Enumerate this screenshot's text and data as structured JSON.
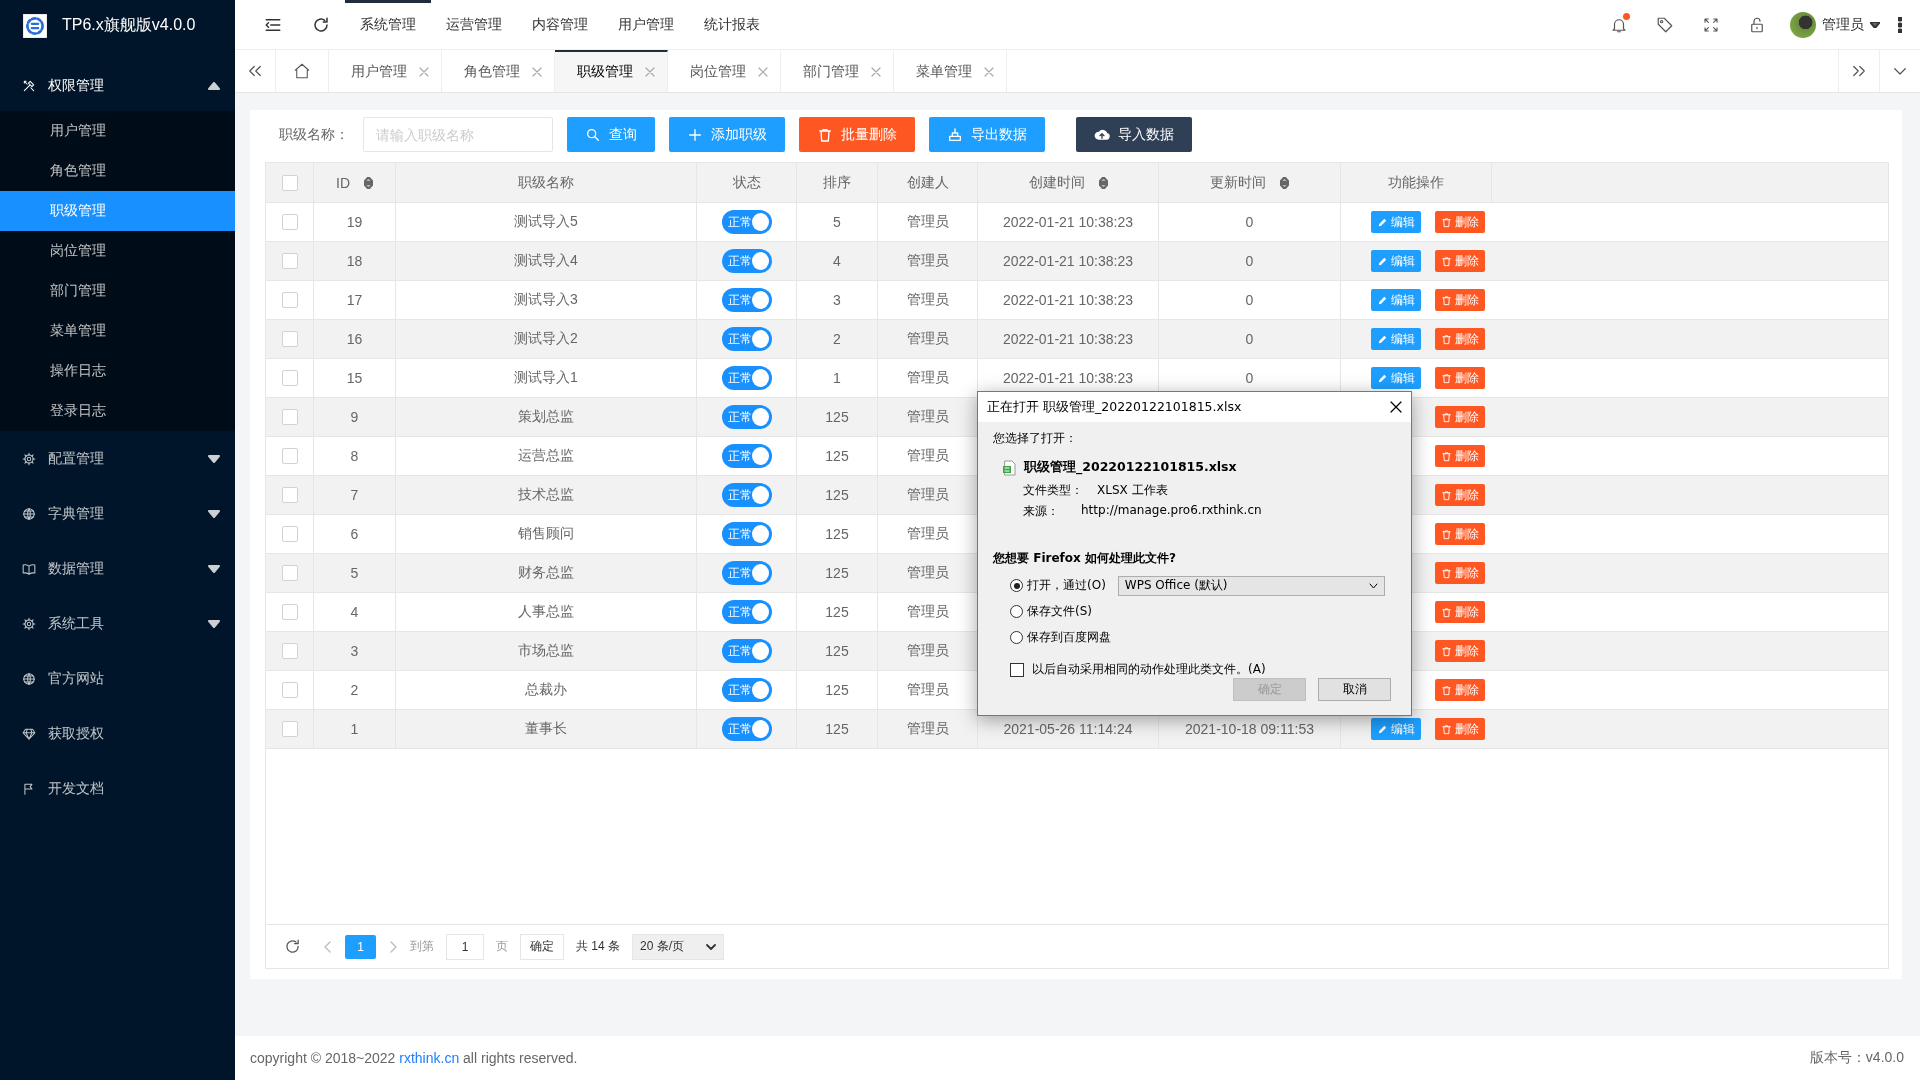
{
  "app": {
    "title": "TP6.x旗舰版v4.0.0"
  },
  "sidebar": {
    "groups": [
      {
        "label": "权限管理",
        "kind": "group",
        "expanded": true,
        "children": [
          {
            "label": "用户管理",
            "selected": false
          },
          {
            "label": "角色管理",
            "selected": false
          },
          {
            "label": "职级管理",
            "selected": true
          },
          {
            "label": "岗位管理",
            "selected": false
          },
          {
            "label": "部门管理",
            "selected": false
          },
          {
            "label": "菜单管理",
            "selected": false
          },
          {
            "label": "操作日志",
            "selected": false
          },
          {
            "label": "登录日志",
            "selected": false
          }
        ]
      },
      {
        "label": "配置管理",
        "kind": "group",
        "expanded": false
      },
      {
        "label": "字典管理",
        "kind": "group",
        "expanded": false
      },
      {
        "label": "数据管理",
        "kind": "group",
        "expanded": false
      },
      {
        "label": "系统工具",
        "kind": "group",
        "expanded": false
      },
      {
        "label": "官方网站",
        "kind": "link"
      },
      {
        "label": "获取授权",
        "kind": "link"
      },
      {
        "label": "开发文档",
        "kind": "link"
      }
    ]
  },
  "header": {
    "nav": [
      {
        "label": "系统管理",
        "selected": true
      },
      {
        "label": "运营管理",
        "selected": false
      },
      {
        "label": "内容管理",
        "selected": false
      },
      {
        "label": "用户管理",
        "selected": false
      },
      {
        "label": "统计报表",
        "selected": false
      }
    ],
    "notifications_unread": true,
    "user": "管理员"
  },
  "tabs": [
    {
      "label": "用户管理",
      "selected": false
    },
    {
      "label": "角色管理",
      "selected": false
    },
    {
      "label": "职级管理",
      "selected": true
    },
    {
      "label": "岗位管理",
      "selected": false
    },
    {
      "label": "部门管理",
      "selected": false
    },
    {
      "label": "菜单管理",
      "selected": false
    }
  ],
  "toolbar": {
    "label": "职级名称：",
    "placeholder": "请输入职级名称",
    "buttons": [
      {
        "label": "查询",
        "kind": "search"
      },
      {
        "label": "添加职级",
        "kind": "add"
      },
      {
        "label": "批量删除",
        "kind": "delete"
      },
      {
        "label": "导出数据",
        "kind": "export"
      },
      {
        "label": "导入数据",
        "kind": "import"
      }
    ]
  },
  "table": {
    "all_checked": false,
    "columns": [
      {
        "label": "ID",
        "sortable": true
      },
      {
        "label": "职级名称",
        "sortable": false
      },
      {
        "label": "状态",
        "sortable": false
      },
      {
        "label": "排序",
        "sortable": false
      },
      {
        "label": "创建人",
        "sortable": false
      },
      {
        "label": "创建时间",
        "sortable": true
      },
      {
        "label": "更新时间",
        "sortable": true
      },
      {
        "label": "功能操作",
        "sortable": false
      }
    ],
    "rows": [
      {
        "checked": false,
        "id": "19",
        "name": "测试导入5",
        "status": "正常",
        "enabled": true,
        "sort": "5",
        "creator": "管理员",
        "created": "2022-01-21 10:38:23",
        "updated": "0",
        "actions": [
          {
            "label": "编辑",
            "kind": "edit"
          },
          {
            "label": "删除",
            "kind": "delete"
          }
        ]
      },
      {
        "checked": false,
        "id": "18",
        "name": "测试导入4",
        "status": "正常",
        "enabled": true,
        "sort": "4",
        "creator": "管理员",
        "created": "2022-01-21 10:38:23",
        "updated": "0",
        "actions": [
          {
            "label": "编辑",
            "kind": "edit"
          },
          {
            "label": "删除",
            "kind": "delete"
          }
        ]
      },
      {
        "checked": false,
        "id": "17",
        "name": "测试导入3",
        "status": "正常",
        "enabled": true,
        "sort": "3",
        "creator": "管理员",
        "created": "2022-01-21 10:38:23",
        "updated": "0",
        "actions": [
          {
            "label": "编辑",
            "kind": "edit"
          },
          {
            "label": "删除",
            "kind": "delete"
          }
        ]
      },
      {
        "checked": false,
        "id": "16",
        "name": "测试导入2",
        "status": "正常",
        "enabled": true,
        "sort": "2",
        "creator": "管理员",
        "created": "2022-01-21 10:38:23",
        "updated": "0",
        "actions": [
          {
            "label": "编辑",
            "kind": "edit"
          },
          {
            "label": "删除",
            "kind": "delete"
          }
        ]
      },
      {
        "checked": false,
        "id": "15",
        "name": "测试导入1",
        "status": "正常",
        "enabled": true,
        "sort": "1",
        "creator": "管理员",
        "created": "2022-01-21 10:38:23",
        "updated": "0",
        "actions": [
          {
            "label": "编辑",
            "kind": "edit"
          },
          {
            "label": "删除",
            "kind": "delete"
          }
        ]
      },
      {
        "checked": false,
        "id": "9",
        "name": "策划总监",
        "status": "正常",
        "enabled": true,
        "sort": "125",
        "creator": "管理员",
        "actions": [
          {
            "label": "删除",
            "kind": "delete"
          }
        ]
      },
      {
        "checked": false,
        "id": "8",
        "name": "运营总监",
        "status": "正常",
        "enabled": true,
        "sort": "125",
        "creator": "管理员",
        "actions": [
          {
            "label": "删除",
            "kind": "delete"
          }
        ]
      },
      {
        "checked": false,
        "id": "7",
        "name": "技术总监",
        "status": "正常",
        "enabled": true,
        "sort": "125",
        "creator": "管理员",
        "actions": [
          {
            "label": "删除",
            "kind": "delete"
          }
        ]
      },
      {
        "checked": false,
        "id": "6",
        "name": "销售顾问",
        "status": "正常",
        "enabled": true,
        "sort": "125",
        "creator": "管理员",
        "actions": [
          {
            "label": "删除",
            "kind": "delete"
          }
        ]
      },
      {
        "checked": false,
        "id": "5",
        "name": "财务总监",
        "status": "正常",
        "enabled": true,
        "sort": "125",
        "creator": "管理员",
        "actions": [
          {
            "label": "删除",
            "kind": "delete"
          }
        ]
      },
      {
        "checked": false,
        "id": "4",
        "name": "人事总监",
        "status": "正常",
        "enabled": true,
        "sort": "125",
        "creator": "管理员",
        "actions": [
          {
            "label": "删除",
            "kind": "delete"
          }
        ]
      },
      {
        "checked": false,
        "id": "3",
        "name": "市场总监",
        "status": "正常",
        "enabled": true,
        "sort": "125",
        "creator": "管理员",
        "actions": [
          {
            "label": "删除",
            "kind": "delete"
          }
        ]
      },
      {
        "checked": false,
        "id": "2",
        "name": "总裁办",
        "status": "正常",
        "enabled": true,
        "sort": "125",
        "creator": "管理员",
        "actions": [
          {
            "label": "删除",
            "kind": "delete"
          }
        ]
      },
      {
        "checked": false,
        "id": "1",
        "name": "董事长",
        "status": "正常",
        "enabled": true,
        "sort": "125",
        "creator": "管理员",
        "created": "2021-05-26 11:14:24",
        "updated": "2021-10-18 09:11:53",
        "actions": [
          {
            "label": "编辑",
            "kind": "edit"
          },
          {
            "label": "删除",
            "kind": "delete"
          }
        ]
      }
    ]
  },
  "pager": {
    "current_page": "1",
    "goto_label": "到第",
    "page_input": "1",
    "page_unit": "页",
    "confirm": "确定",
    "total": "共 14 条",
    "page_size": "20 条/页"
  },
  "dialog": {
    "title": "正在打开 职级管理_20220122101815.xlsx",
    "intro": "您选择了打开：",
    "file_name": "职级管理_20220122101815.xlsx",
    "type_label": "文件类型：",
    "type_value": "XLSX 工作表",
    "source_label": "来源：",
    "source_value": "http://manage.pro6.rxthink.cn",
    "question": "您想要 Firefox 如何处理此文件?",
    "options": [
      {
        "label": "打开，通过(O)",
        "selected": true,
        "app": "WPS Office (默认)"
      },
      {
        "label": "保存文件(S)",
        "selected": false
      },
      {
        "label": "保存到百度网盘",
        "selected": false
      }
    ],
    "remember": {
      "label": "以后自动采用相同的动作处理此类文件。(A)",
      "checked": false
    },
    "buttons": [
      {
        "label": "确定",
        "disabled": true
      },
      {
        "label": "取消",
        "disabled": false
      }
    ]
  },
  "footer": {
    "copyright_before": "copyright © 2018~2022 ",
    "link": "rxthink.cn",
    "copyright_after": " all rights reserved.",
    "version": "版本号：v4.0.0"
  }
}
